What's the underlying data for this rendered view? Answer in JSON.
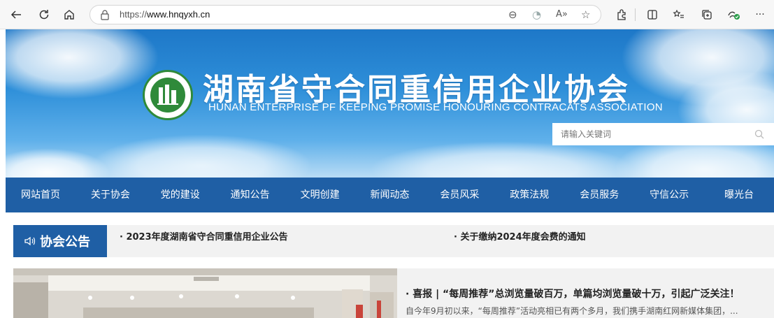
{
  "browser": {
    "url_prefix": "https://",
    "url_domain": "www.hnqyxh.cn",
    "icons": [
      "back-icon",
      "refresh-icon",
      "home-icon",
      "lock-icon",
      "zoom-icon",
      "tracking-icon",
      "read-aloud-icon",
      "favorite-icon",
      "extensions-icon",
      "split-screen-icon",
      "favorites-list-icon",
      "collections-icon",
      "performance-icon",
      "more-icon"
    ]
  },
  "banner": {
    "title": "湖南省守合同重信用企业协会",
    "subtitle": "HUNAN ENTERPRISE PF KEEPING PROMISE HONOURING CONTRACATS ASSOCIATION",
    "search_placeholder": "请输入关键词"
  },
  "nav": {
    "items": [
      "网站首页",
      "关于协会",
      "党的建设",
      "通知公告",
      "文明创建",
      "新闻动态",
      "会员风采",
      "政策法规",
      "会员服务",
      "守信公示",
      "曝光台"
    ]
  },
  "notice": {
    "label": "协会公告",
    "links": [
      "· 2023年度湖南省守合同重信用企业公告",
      "· 关于缴纳2024年度会费的通知"
    ]
  },
  "news": {
    "title": "· 喜报 | “每周推荐”总浏览量破百万，单篇均浏览量破十万，引起广泛关注！",
    "desc": "自今年9月初以来，“每周推荐”活动亮相已有两个多月，我们携手湖南红网新媒体集团，..."
  },
  "colors": {
    "nav_bg": "#1f5fa5",
    "banner_sky": "#2e8fd9",
    "logo_green": "#2f8a3a"
  }
}
